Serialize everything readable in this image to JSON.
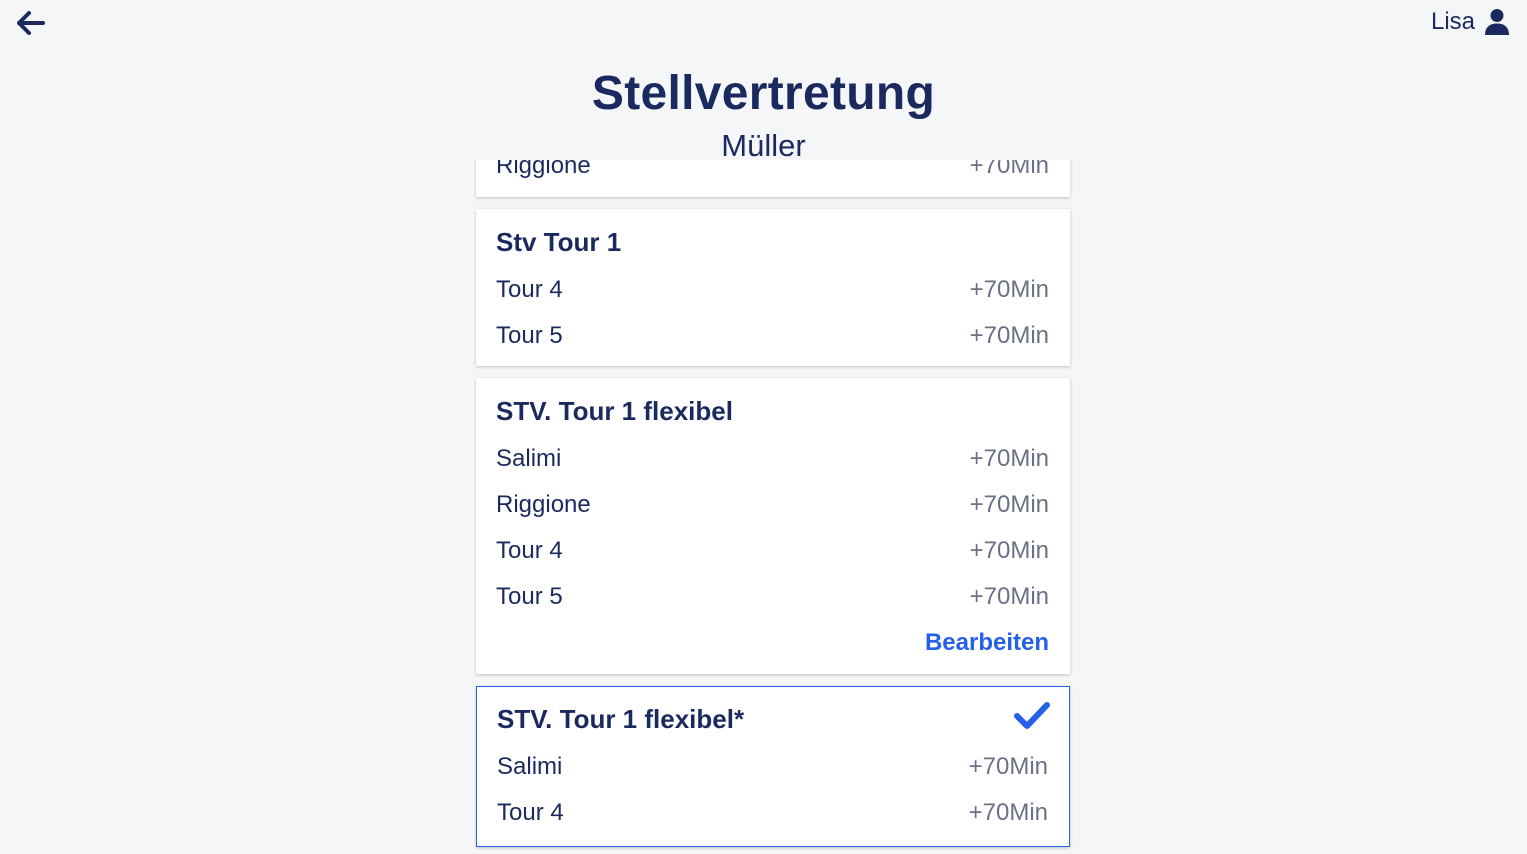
{
  "header": {
    "back_icon": "arrow-left-icon",
    "user_name": "Lisa",
    "user_icon": "user-icon"
  },
  "title": "Stellvertretung",
  "subtitle": "Müller",
  "colors": {
    "primary_text": "#1b2a5e",
    "secondary_text": "#6b7185",
    "accent": "#2561e8",
    "background": "#f5f6f8"
  },
  "cards": [
    {
      "rows": [
        {
          "label": "Riggione",
          "duration": "+70Min"
        }
      ]
    },
    {
      "title": "Stv Tour 1",
      "rows": [
        {
          "label": "Tour 4",
          "duration": "+70Min"
        },
        {
          "label": "Tour 5",
          "duration": "+70Min"
        }
      ]
    },
    {
      "title": "STV. Tour 1 flexibel",
      "rows": [
        {
          "label": "Salimi",
          "duration": "+70Min"
        },
        {
          "label": "Riggione",
          "duration": "+70Min"
        },
        {
          "label": "Tour 4",
          "duration": "+70Min"
        },
        {
          "label": "Tour 5",
          "duration": "+70Min"
        }
      ],
      "action": "Bearbeiten"
    },
    {
      "title": "STV. Tour 1 flexibel*",
      "selected": true,
      "selected_icon": "checkmark-icon",
      "rows": [
        {
          "label": "Salimi",
          "duration": "+70Min"
        },
        {
          "label": "Tour 4",
          "duration": "+70Min"
        }
      ]
    }
  ]
}
